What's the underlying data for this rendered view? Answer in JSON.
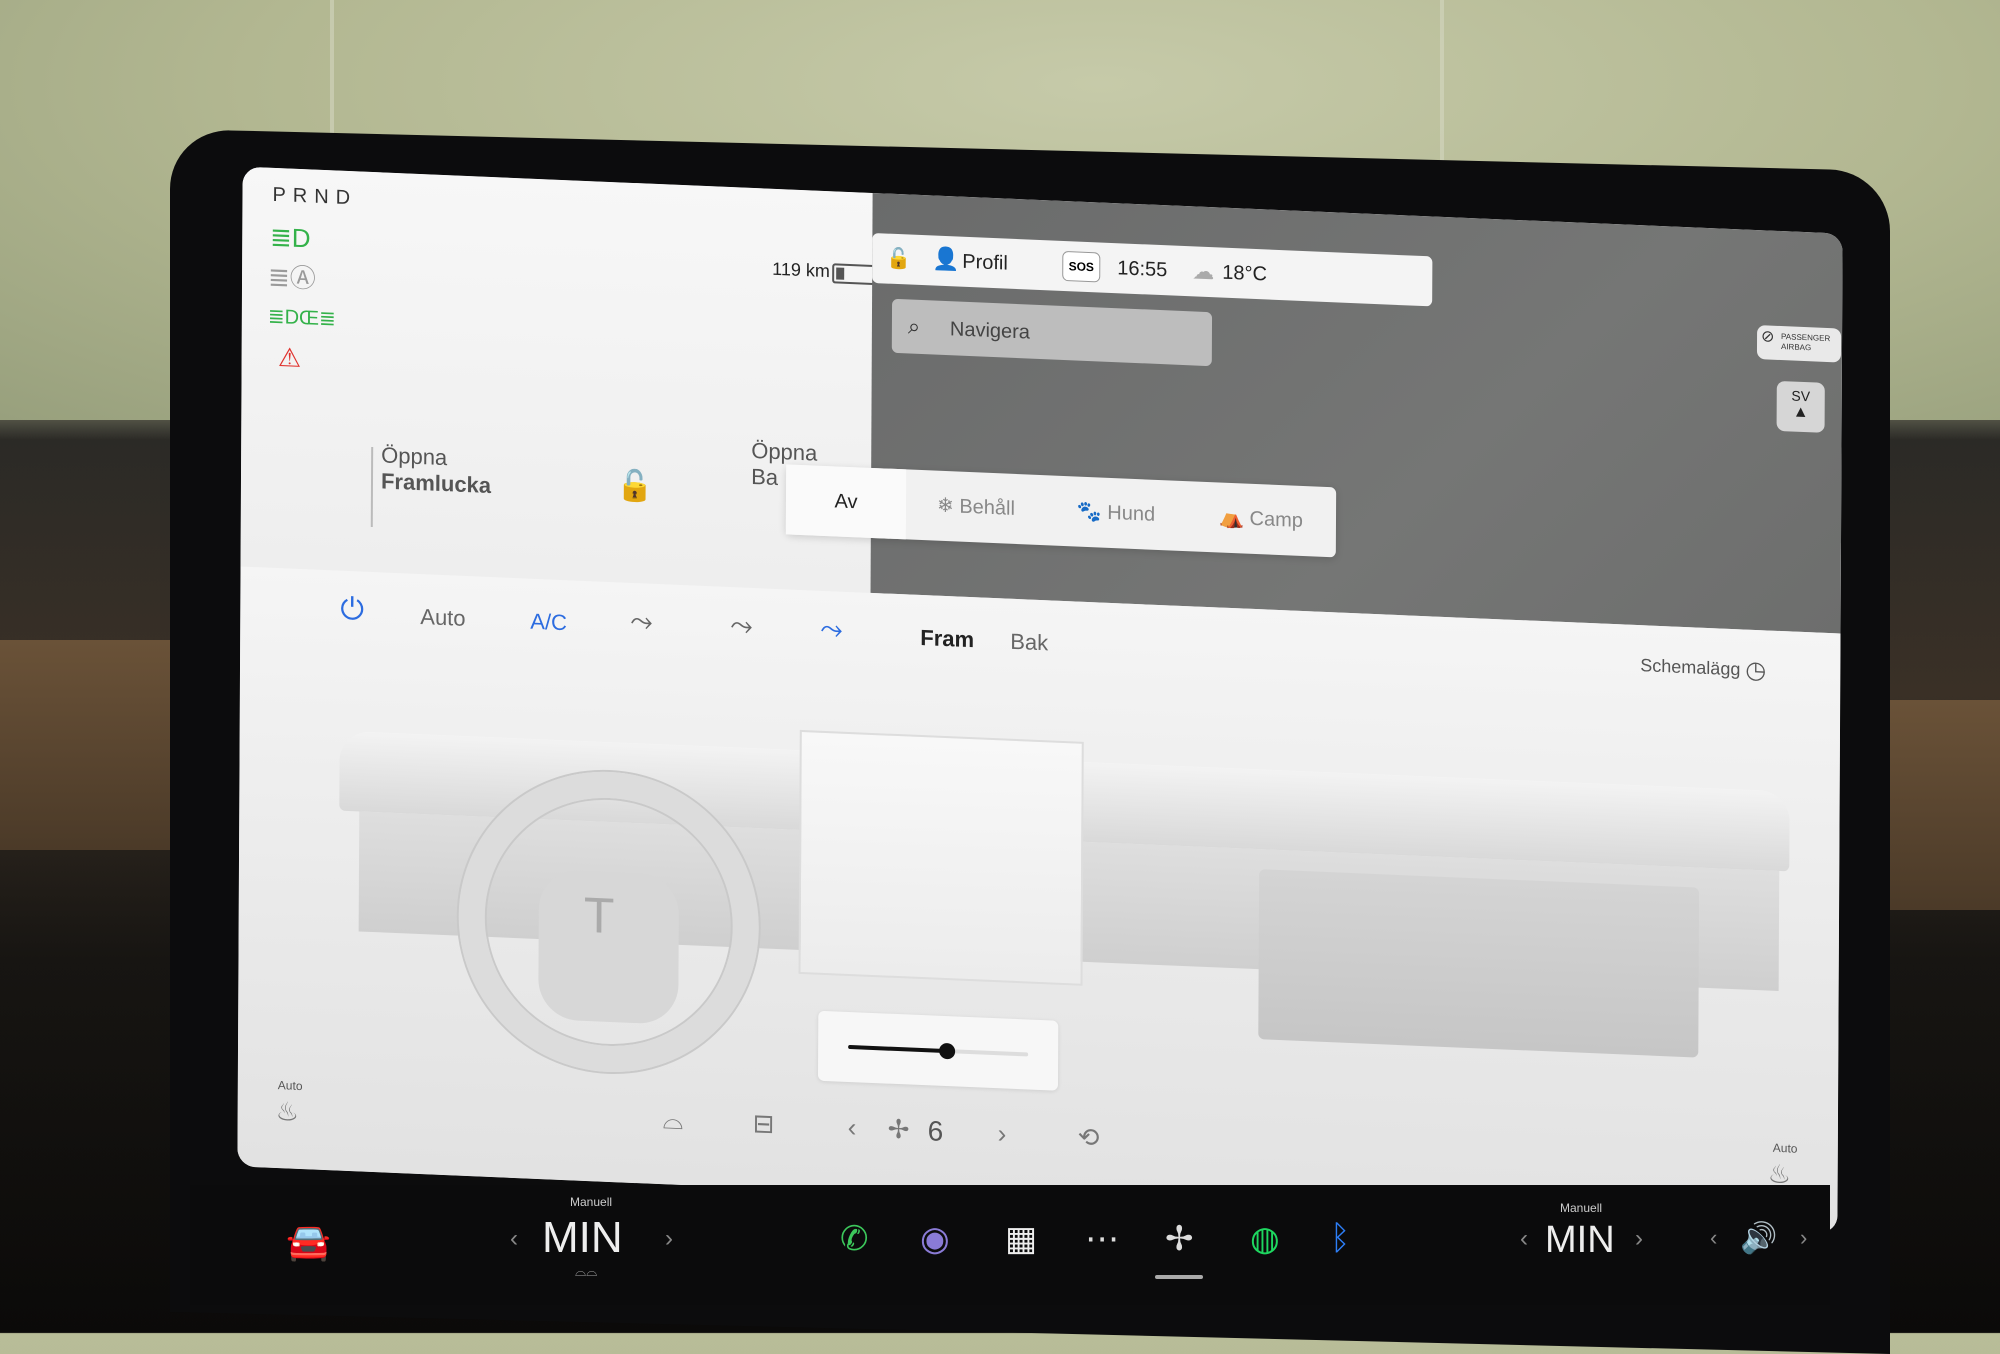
{
  "car_panel": {
    "gear": "PRND",
    "range": "119 km",
    "frunk_label_line1": "Öppna",
    "frunk_label_line2": "Framlucka",
    "trunk_label_line1": "Öppna",
    "trunk_label_line2": "Ba",
    "indicator_icons": [
      {
        "name": "headlights-icon",
        "color": "#34b24a"
      },
      {
        "name": "auto-high-beam-icon",
        "color": "#9a9a9a"
      },
      {
        "name": "parking-lights-icon",
        "color": "#34b24a"
      },
      {
        "name": "seatbelt-warning-icon",
        "color": "#e0332f"
      }
    ]
  },
  "status_bar": {
    "profile_label": "Profil",
    "sos_label": "SOS",
    "time": "16:55",
    "temperature": "18°C"
  },
  "map": {
    "search_placeholder": "Navigera",
    "airbag_badge_line1": "PASSENGER",
    "airbag_badge_line2": "AIRBAG",
    "compass_heading": "SV"
  },
  "overheat_popup": {
    "options": [
      "Av",
      "Behåll",
      "Hund",
      "Camp"
    ],
    "selected": "Av"
  },
  "climate": {
    "auto_label": "Auto",
    "ac_label": "A/C",
    "front_tab": "Fram",
    "rear_tab": "Bak",
    "schedule_label": "Schemalägg",
    "fan_speed": "6",
    "seat_heat_left_label": "Auto",
    "seat_heat_right_label": "Auto",
    "temperature_slider_fraction": 0.55
  },
  "taskbar": {
    "left_temp_value": "MIN",
    "left_temp_mode": "Manuell",
    "right_temp_value": "MIN",
    "right_temp_mode": "Manuell",
    "accent_colors": {
      "phone": "#3cc75b",
      "spotify": "#1ed760",
      "bluetooth": "#2d7ef7"
    }
  }
}
